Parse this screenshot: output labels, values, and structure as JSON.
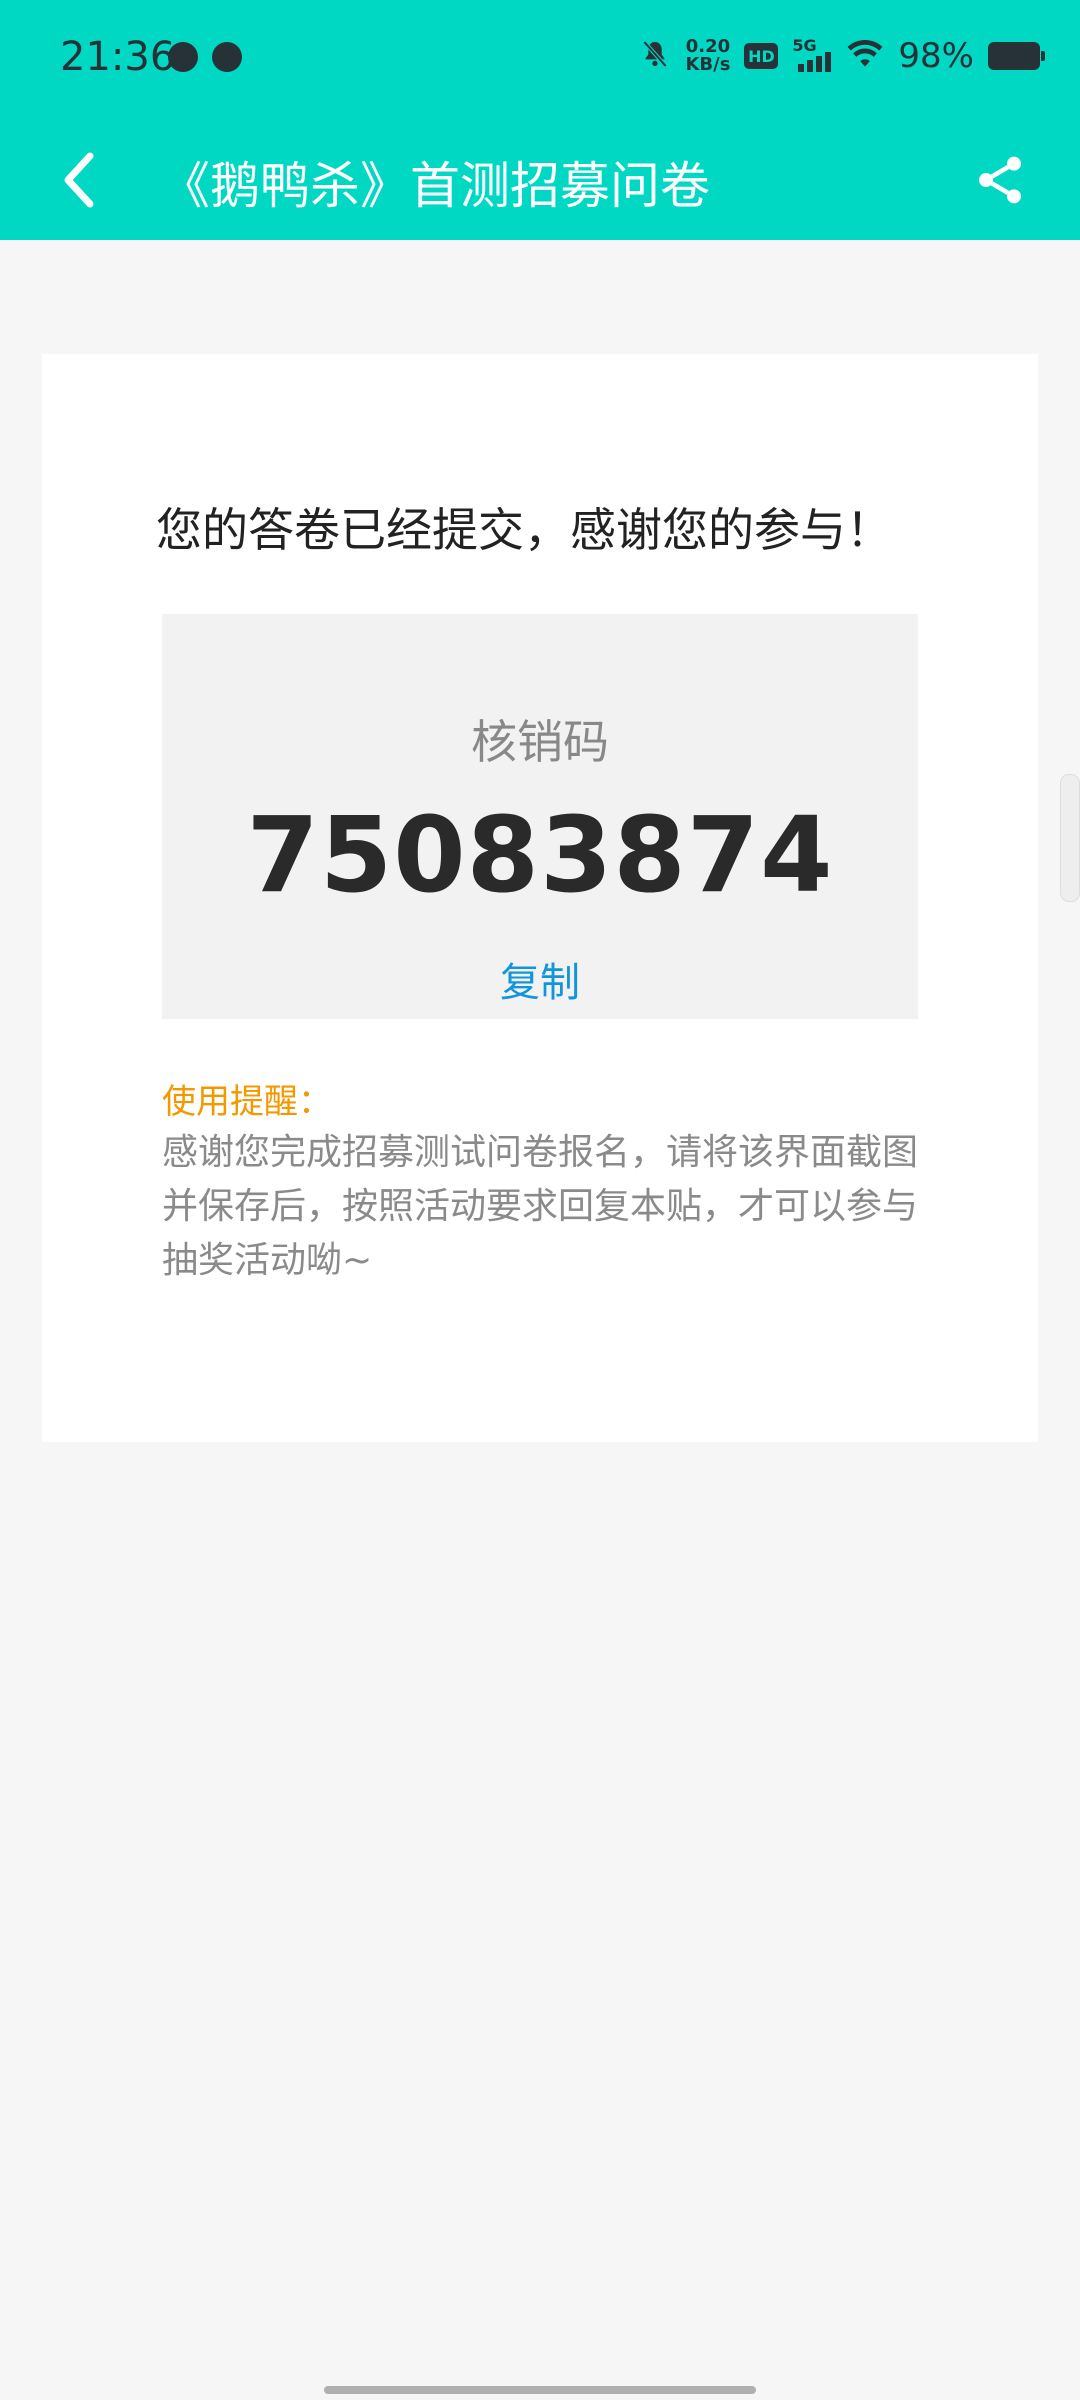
{
  "status_bar": {
    "time": "21:36",
    "net_speed_value": "0.20",
    "net_speed_unit": "KB/s",
    "hd_label": "HD",
    "signal_label": "5G",
    "battery_text": "98%"
  },
  "header": {
    "title": "《鹅鸭杀》首测招募问卷",
    "back_icon": "chevron-left-icon",
    "share_icon": "share-icon"
  },
  "card": {
    "success_message": "您的答卷已经提交，感谢您的参与！",
    "code_label": "核销码",
    "code_value": "75083874",
    "copy_label": "复制",
    "reminder_title": "使用提醒：",
    "reminder_text": "感谢您完成招募测试问卷报名，请将该界面截图并保存后，按照活动要求回复本贴，才可以参与抽奖活动呦~"
  },
  "colors": {
    "header_bg": "#00d8c4",
    "page_bg": "#f6f6f6",
    "copy_link": "#1296db",
    "reminder_title": "#f39800"
  }
}
